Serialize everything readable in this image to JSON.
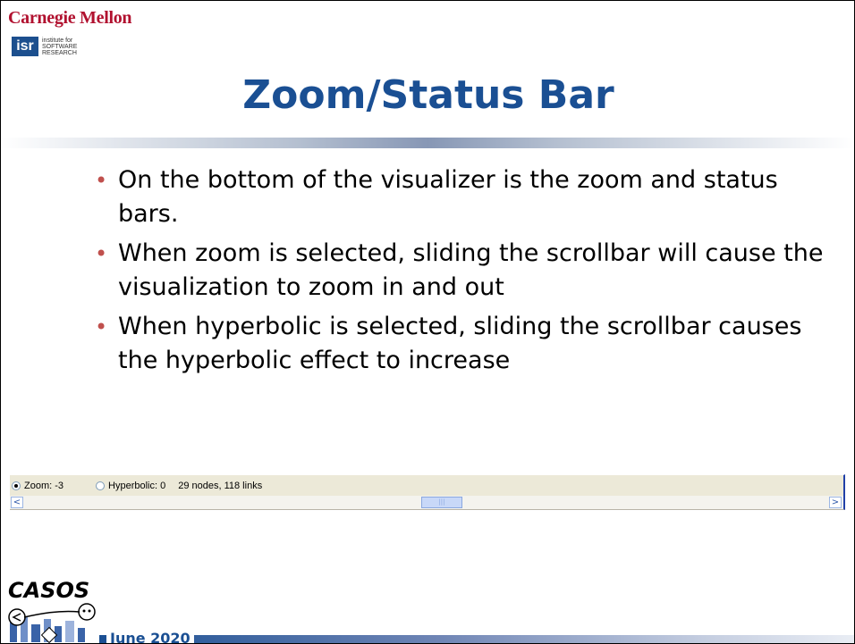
{
  "header": {
    "org_name": "Carnegie Mellon",
    "isr_abbr": "isr",
    "isr_line1": "institute for",
    "isr_line2": "SOFTWARE",
    "isr_line3": "RESEARCH"
  },
  "slide": {
    "title": "Zoom/Status Bar",
    "bullets": [
      "On the bottom of the visualizer is the zoom and status bars.",
      "When zoom is selected, sliding the scrollbar will cause the visualization to zoom in and out",
      "When hyperbolic is selected, sliding the scrollbar causes the hyperbolic effect to increase"
    ]
  },
  "statusbar": {
    "zoom_label": "Zoom: -3",
    "zoom_selected": true,
    "hyperbolic_label": "Hyperbolic: 0",
    "hyperbolic_selected": false,
    "status_text": "29 nodes, 118 links",
    "scroll_left": "<",
    "scroll_right": ">"
  },
  "footer": {
    "logo_text": "CASOS",
    "date": "June 2020"
  },
  "colors": {
    "title": "#1a4f93",
    "bullet": "#c0504d",
    "cmu_red": "#b1112f",
    "isr_blue": "#1c4f8e"
  }
}
